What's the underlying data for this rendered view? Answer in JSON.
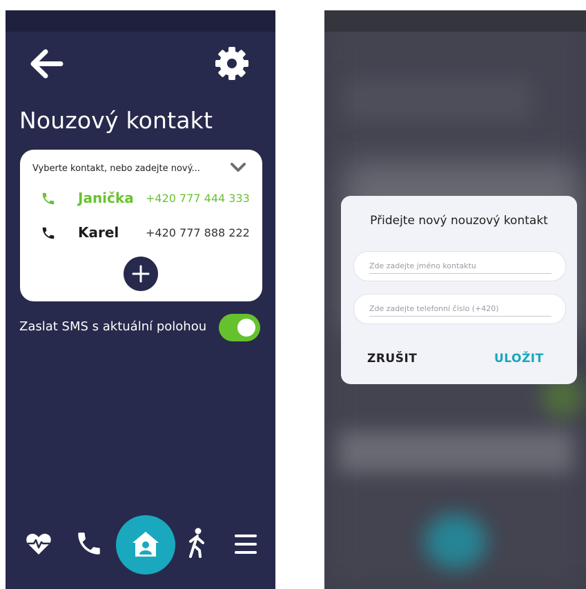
{
  "left_screen": {
    "page_title": "Nouzový kontakt",
    "contact_select": {
      "placeholder": "Vyberte kontakt, nebo zadejte nový..."
    },
    "contacts": [
      {
        "name": "Janička",
        "phone": "+420 777 444 333",
        "selected": true
      },
      {
        "name": "Karel",
        "phone": "+420 777 888 222",
        "selected": false
      }
    ],
    "sms_option": {
      "label": "Zaslat SMS s aktuální polohou",
      "enabled": true
    },
    "bottom_nav": [
      {
        "icon": "heart-pulse-icon"
      },
      {
        "icon": "phone-icon"
      },
      {
        "icon": "home-user-icon",
        "active": true
      },
      {
        "icon": "walking-person-icon"
      },
      {
        "icon": "menu-icon"
      }
    ]
  },
  "right_screen": {
    "dialog": {
      "title": "Přidejte nový nouzový kontakt",
      "name_placeholder": "Zde zadejte jméno kontaktu",
      "phone_placeholder": "Zde zadejte telefonní číslo (+420)",
      "cancel_label": "ZRUŠIT",
      "save_label": "ULOŽIT"
    }
  },
  "colors": {
    "background": "#272a4c",
    "accent_green": "#6ac22f",
    "accent_teal": "#1aa8bf"
  }
}
